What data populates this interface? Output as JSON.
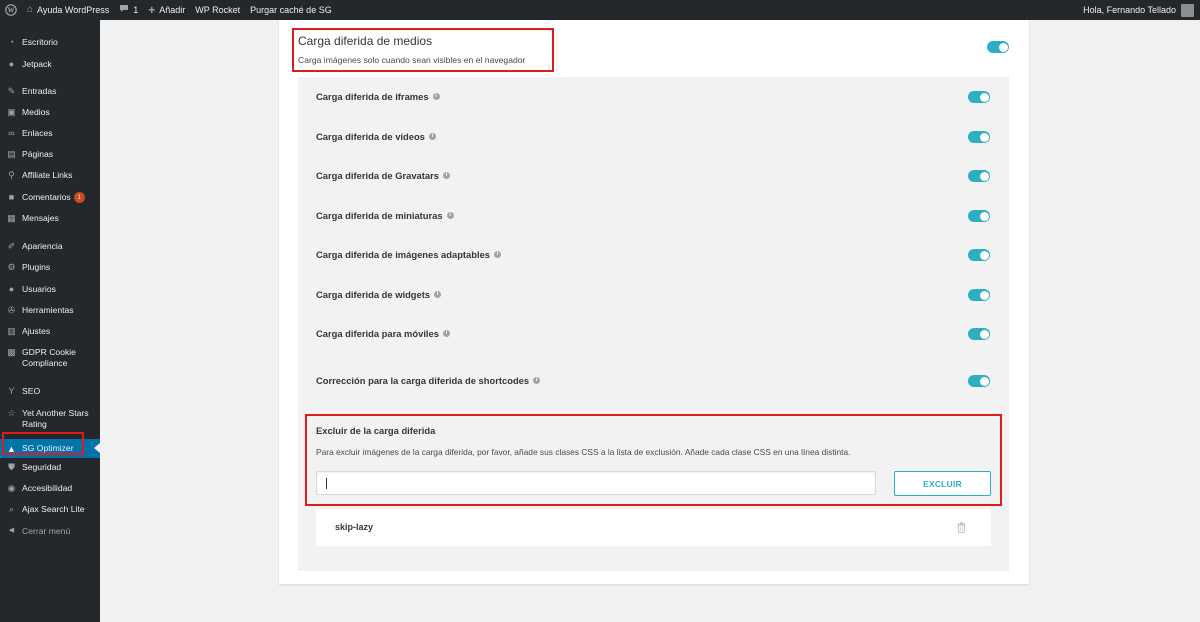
{
  "adminbar": {
    "site_name": "Ayuda WordPress",
    "comments_count": "1",
    "new_label": "Añadir",
    "wp_rocket": "WP Rocket",
    "purge_cache": "Purgar caché de SG",
    "greeting": "Hola, Fernando Tellado"
  },
  "sidebar": {
    "items": [
      {
        "label": "Escritorio",
        "icon": "dashboard-icon"
      },
      {
        "label": "Jetpack",
        "icon": "jetpack-icon"
      },
      {
        "label": "Entradas",
        "icon": "pin-icon"
      },
      {
        "label": "Medios",
        "icon": "media-icon"
      },
      {
        "label": "Enlaces",
        "icon": "link-icon"
      },
      {
        "label": "Páginas",
        "icon": "page-icon"
      },
      {
        "label": "Affiliate Links",
        "icon": "affiliate-link-icon"
      },
      {
        "label": "Comentarios",
        "icon": "comment-icon",
        "badge": "1"
      },
      {
        "label": "Mensajes",
        "icon": "messages-icon"
      },
      {
        "label": "Apariencia",
        "icon": "brush-icon"
      },
      {
        "label": "Plugins",
        "icon": "plugin-icon"
      },
      {
        "label": "Usuarios",
        "icon": "users-icon"
      },
      {
        "label": "Herramientas",
        "icon": "wrench-icon"
      },
      {
        "label": "Ajustes",
        "icon": "settings-icon"
      },
      {
        "label": "GDPR Cookie Compliance",
        "icon": "gdpr-icon"
      },
      {
        "label": "SEO",
        "icon": "seo-icon"
      },
      {
        "label": "Yet Another Stars Rating",
        "icon": "star-icon"
      },
      {
        "label": "SG Optimizer",
        "icon": "sg-optimizer-icon",
        "active": true
      },
      {
        "label": "Seguridad",
        "icon": "shield-icon"
      },
      {
        "label": "Accesibilidad",
        "icon": "accessibility-icon"
      },
      {
        "label": "Ajax Search Lite",
        "icon": "search-icon"
      },
      {
        "label": "Cerrar menú",
        "icon": "collapse-icon"
      }
    ]
  },
  "media": {
    "title": "Carga diferida de medios",
    "description": "Carga imágenes solo cuando sean visibles en el navegador",
    "enabled": true
  },
  "options": [
    {
      "label": "Carga diferida de iframes",
      "enabled": true
    },
    {
      "label": "Carga diferida de vídeos",
      "enabled": true
    },
    {
      "label": "Carga diferida de Gravatars",
      "enabled": true
    },
    {
      "label": "Carga diferida de miniaturas",
      "enabled": true
    },
    {
      "label": "Carga diferida de imágenes adaptables",
      "enabled": true
    },
    {
      "label": "Carga diferida de widgets",
      "enabled": true
    },
    {
      "label": "Carga diferida para móviles",
      "enabled": true
    },
    {
      "label": "Corrección para la carga diferida de shortcodes",
      "enabled": true
    }
  ],
  "exclude": {
    "title": "Excluir de la carga diferida",
    "description": "Para excluir imágenes de la carga diferida, por favor, añade sus clases CSS a la lista de exclusión. Añade cada clase CSS en una línea distinta.",
    "input_value": "",
    "button": "EXCLUIR",
    "items": [
      "skip-lazy"
    ]
  },
  "colors": {
    "accent": "#2eaec1",
    "highlight": "#e01b1b",
    "sidebar_bg": "#23282d",
    "active_bg": "#0073aa"
  }
}
